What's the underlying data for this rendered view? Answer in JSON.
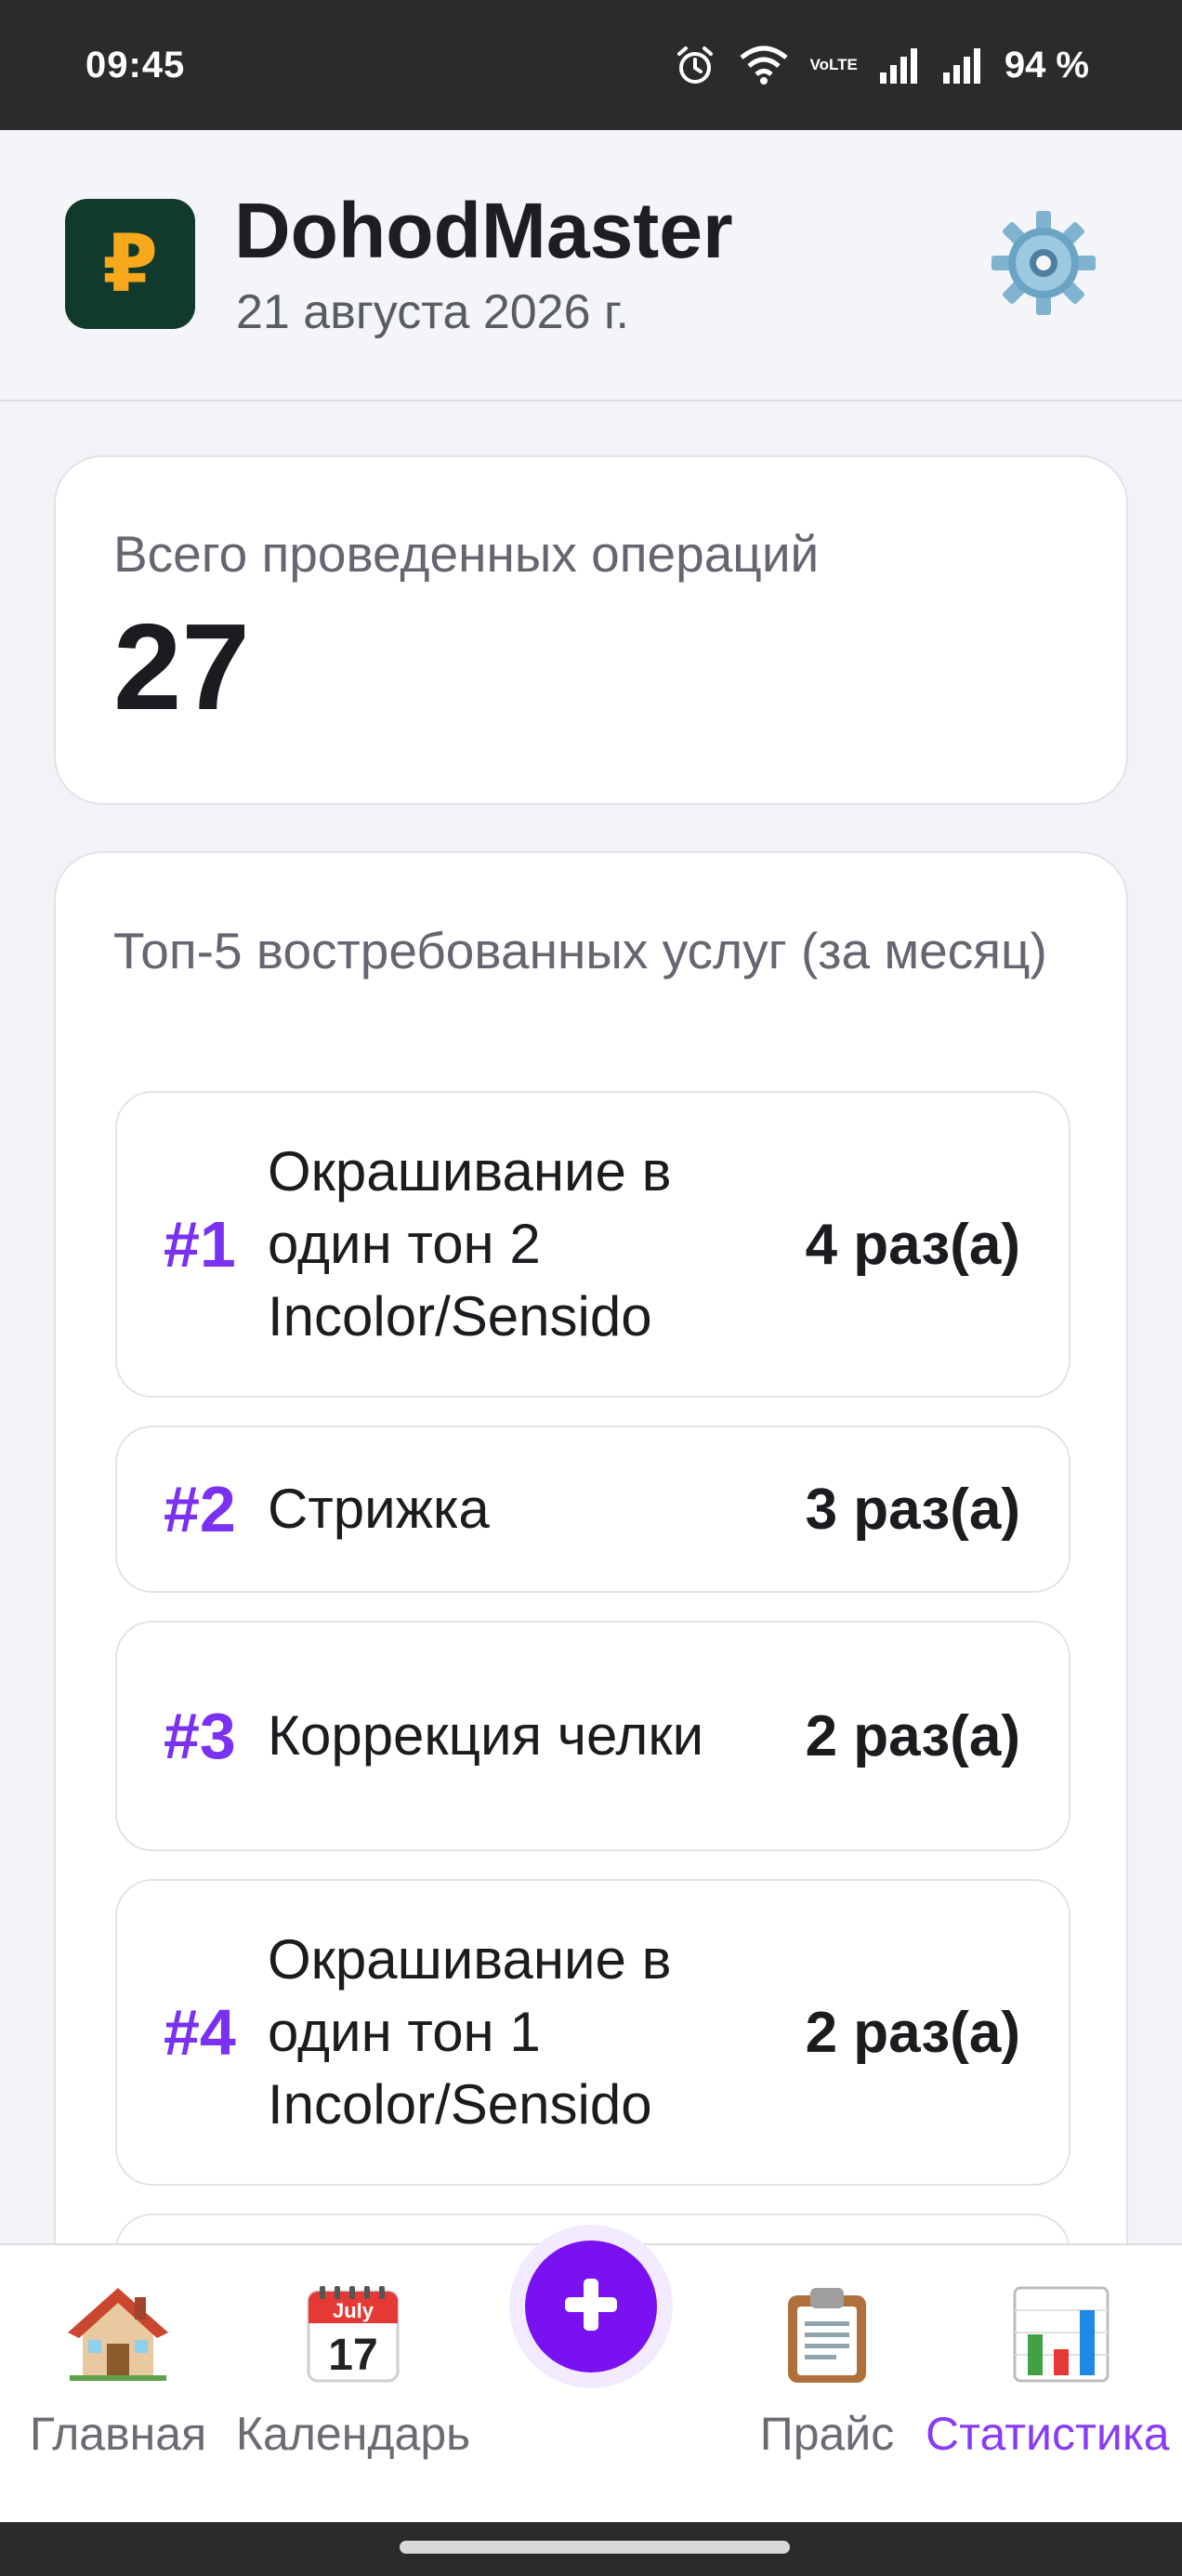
{
  "status_bar": {
    "time": "09:45",
    "volte_line1": "Vo",
    "volte_line2": "LTE",
    "battery": "94 %"
  },
  "header": {
    "logo_symbol": "₽",
    "title": "DohodMaster",
    "date": "21 августа 2026 г.",
    "settings_icon": "gear-icon"
  },
  "total_card": {
    "label": "Всего проведенных операций",
    "value": "27"
  },
  "top_services": {
    "title": "Топ-5 востребованных услуг (за месяц)",
    "items": [
      {
        "rank": "#1",
        "name": "Окрашивание в один тон 2 Incolor/Sensido",
        "count": "4 раз(а)"
      },
      {
        "rank": "#2",
        "name": "Стрижка",
        "count": "3 раз(а)"
      },
      {
        "rank": "#3",
        "name": "Коррекция челки",
        "count": "2 раз(а)"
      },
      {
        "rank": "#4",
        "name": "Окрашивание в один тон 1 Incolor/Sensido",
        "count": "2 раз(а)"
      },
      {
        "rank": "",
        "name": "",
        "count": ""
      }
    ]
  },
  "bottom_nav": {
    "home": "Главная",
    "calendar": "Календарь",
    "calendar_month": "July",
    "calendar_day": "17",
    "price": "Прайс",
    "stats": "Статистика",
    "active": "stats"
  },
  "colors": {
    "accent": "#7a11f0",
    "rank": "#7a31f2",
    "logo_bg": "#113a2c",
    "logo_fg": "#f7a81b"
  }
}
